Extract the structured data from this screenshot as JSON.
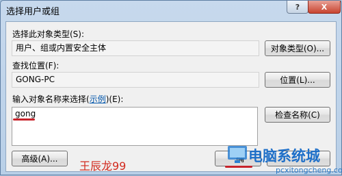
{
  "window": {
    "title": "选择用户或组",
    "help_glyph": "?",
    "close_glyph": "X"
  },
  "object_type": {
    "label": "选择此对象类型(S):",
    "value": "用户、组或内置安全主体",
    "button": "对象类型(O)..."
  },
  "location": {
    "label": "查找位置(F):",
    "value": "GONG-PC",
    "button": "位置(L)..."
  },
  "names": {
    "label_prefix": "输入对象名称来选择(",
    "label_link": "示例",
    "label_suffix": ")(E):",
    "value": "gong",
    "check_button": "检查名称(C)"
  },
  "footer": {
    "advanced_button": "高级(A)...",
    "ok_button": "确",
    "cancel_button": ""
  },
  "annotation": {
    "text": "王辰龙99",
    "color": "#d22a1e"
  },
  "watermark": {
    "title": "电脑系统城",
    "url": "pcxitongcheng.com"
  },
  "colors": {
    "accent_red": "#c8222a",
    "link": "#0055aa"
  }
}
